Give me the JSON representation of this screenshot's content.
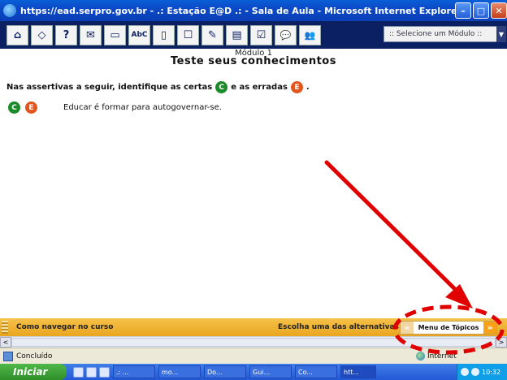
{
  "window": {
    "title": "https://ead.serpro.gov.br - .: Estação E@D .: - Sala de Aula - Microsoft Internet Explorer",
    "minimize": "–",
    "maximize": "□",
    "close": "✕"
  },
  "toolbar": {
    "buttons": [
      {
        "icon": "home-icon",
        "glyph": "⌂"
      },
      {
        "icon": "diamond-icon",
        "glyph": "◇"
      },
      {
        "icon": "help-icon",
        "glyph": "?"
      },
      {
        "icon": "mail-icon",
        "glyph": "✉"
      },
      {
        "icon": "window-icon",
        "glyph": "▭"
      },
      {
        "icon": "abc-icon",
        "glyph": "AbC"
      },
      {
        "icon": "document-icon",
        "glyph": "▯"
      },
      {
        "icon": "book-icon",
        "glyph": "☐"
      },
      {
        "icon": "edit-icon",
        "glyph": "✎"
      },
      {
        "icon": "notes-icon",
        "glyph": "▤"
      },
      {
        "icon": "check-icon",
        "glyph": "☑"
      },
      {
        "icon": "chat-icon",
        "glyph": "💬"
      },
      {
        "icon": "people-icon",
        "glyph": "👥"
      }
    ],
    "module_select": ":: Selecione um Módulo ::"
  },
  "content": {
    "module_label": "Módulo 1",
    "heading": "Teste seus conhecimentos",
    "instructions_before": "Nas assertivas a seguir, identifique as certas",
    "instructions_middle": "e as erradas",
    "instructions_end": ".",
    "badge_correct": "C",
    "badge_wrong": "E",
    "assertion": "Educar é formar para autogovernar-se."
  },
  "navbar": {
    "how_to": "Como navegar no curso",
    "choose": "Escolha uma das alternativas",
    "topics_menu": "Menu de Tópicos",
    "prev": "«",
    "next": "»"
  },
  "scrollbar": {
    "left": "<",
    "right": ">"
  },
  "status": {
    "text": "Concluído",
    "zone": "Internet"
  },
  "taskbar": {
    "start": "Iniciar",
    "tasks": [
      ".: ...",
      "mo...",
      "Do...",
      "Gui...",
      "Co...",
      "htt..."
    ],
    "clock": "10:32"
  },
  "colors": {
    "title_bar": "#0b49c7",
    "toolbar_bg": "#0b1f63",
    "navbar": "#f0b331",
    "correct": "#1b8b2a",
    "wrong": "#e2561d",
    "annotation_red": "#e00000"
  }
}
